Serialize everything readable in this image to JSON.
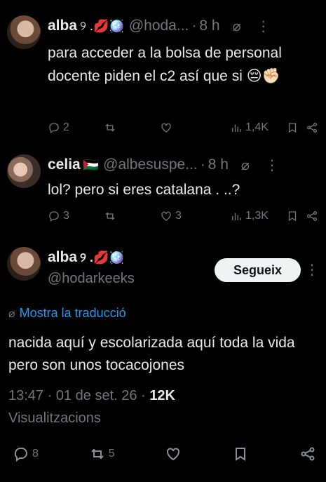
{
  "reply1": {
    "name": "alba",
    "emojis": "୨ .💋🪩",
    "handle": "@hoda...",
    "separator": "·",
    "time": "8 h",
    "text": "para acceder a la bolsa de personal docente piden el c2 así que si 😔✊🏻",
    "replies": "2",
    "reposts": "",
    "likes": "",
    "views": "1,4K"
  },
  "reply2": {
    "name": "celia",
    "emojis": "🇵🇸",
    "handle": "@albesuspe...",
    "separator": "·",
    "time": "8 h",
    "text": "lol? pero si eres catalana . ..?",
    "replies": "3",
    "reposts": "",
    "likes": "3",
    "views": "1,3K"
  },
  "main": {
    "name": "alba",
    "emojis": "୨ .💋🪩",
    "handle": "@hodarkeeks",
    "follow_label": "Segueix",
    "translate_label": "Mostra la traducció",
    "text": "nacida aquí y escolarizada aquí toda la vida pero son unos tocacojones",
    "time": "13:47",
    "date": "01 de set. 26",
    "dot": "·",
    "views_count": "12K",
    "views_label": "Visualitzacions",
    "replies": "8",
    "reposts": "5"
  }
}
